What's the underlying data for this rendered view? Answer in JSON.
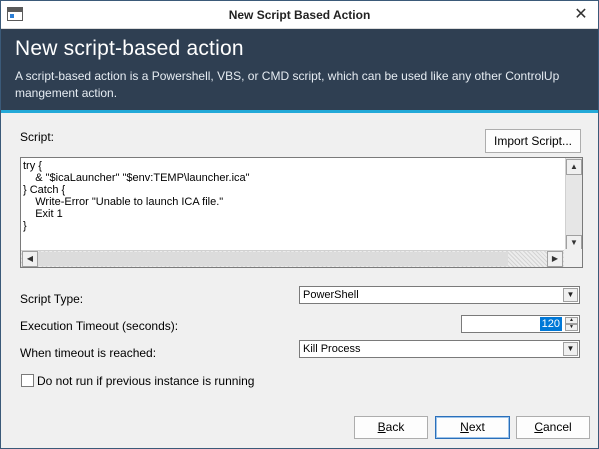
{
  "window": {
    "title": "New Script Based Action",
    "close_glyph": "✕"
  },
  "banner": {
    "heading": "New script-based action",
    "description": "A script-based action is a Powershell, VBS, or CMD script, which can be used like any other ControlUp mangement action.",
    "accent_color": "#23a9d8",
    "background_color": "#2f3f52"
  },
  "script": {
    "label": "Script:",
    "import_button": "Import Script...",
    "code": "try {\n    & \"$icaLauncher\" \"$env:TEMP\\launcher.ica\"\n} Catch {\n    Write-Error \"Unable to launch ICA file.\"\n    Exit 1\n}"
  },
  "script_type": {
    "label": "Script Type:",
    "value": "PowerShell"
  },
  "execution_timeout": {
    "label": "Execution Timeout (seconds):",
    "value": "120"
  },
  "timeout_action": {
    "label": "When timeout is reached:",
    "value": "Kill Process"
  },
  "no_parallel": {
    "label": "Do not run if previous instance is running",
    "checked": false
  },
  "footer": {
    "back_prefix": "",
    "back_mnemonic": "B",
    "back_rest": "ack",
    "next_prefix": "",
    "next_mnemonic": "N",
    "next_rest": "ext",
    "cancel_prefix": "",
    "cancel_mnemonic": "C",
    "cancel_rest": "ancel"
  },
  "icons": {
    "app": "app-window-icon",
    "arrow_up": "▲",
    "arrow_down": "▼",
    "arrow_left": "◀",
    "arrow_right": "▶"
  }
}
